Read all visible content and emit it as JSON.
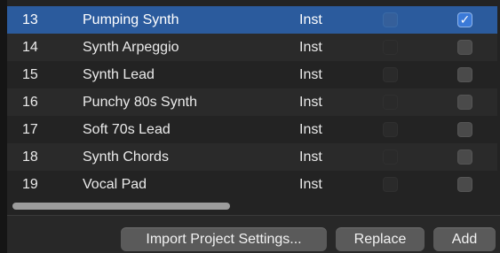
{
  "rows": [
    {
      "num": "13",
      "name": "Pumping Synth",
      "type": "Inst",
      "checked": true,
      "selected": true
    },
    {
      "num": "14",
      "name": "Synth Arpeggio",
      "type": "Inst",
      "checked": false,
      "selected": false
    },
    {
      "num": "15",
      "name": "Synth Lead",
      "type": "Inst",
      "checked": false,
      "selected": false
    },
    {
      "num": "16",
      "name": "Punchy 80s Synth",
      "type": "Inst",
      "checked": false,
      "selected": false
    },
    {
      "num": "17",
      "name": "Soft 70s Lead",
      "type": "Inst",
      "checked": false,
      "selected": false
    },
    {
      "num": "18",
      "name": "Synth Chords",
      "type": "Inst",
      "checked": false,
      "selected": false
    },
    {
      "num": "19",
      "name": "Vocal Pad",
      "type": "Inst",
      "checked": false,
      "selected": false
    }
  ],
  "checkmark_glyph": "✓",
  "buttons": {
    "import_label": "Import Project Settings...",
    "replace_label": "Replace",
    "add_label": "Add"
  },
  "colors": {
    "selection": "#2b5b9d",
    "checkbox_checked": "#3b7ad8",
    "background": "#232323"
  }
}
